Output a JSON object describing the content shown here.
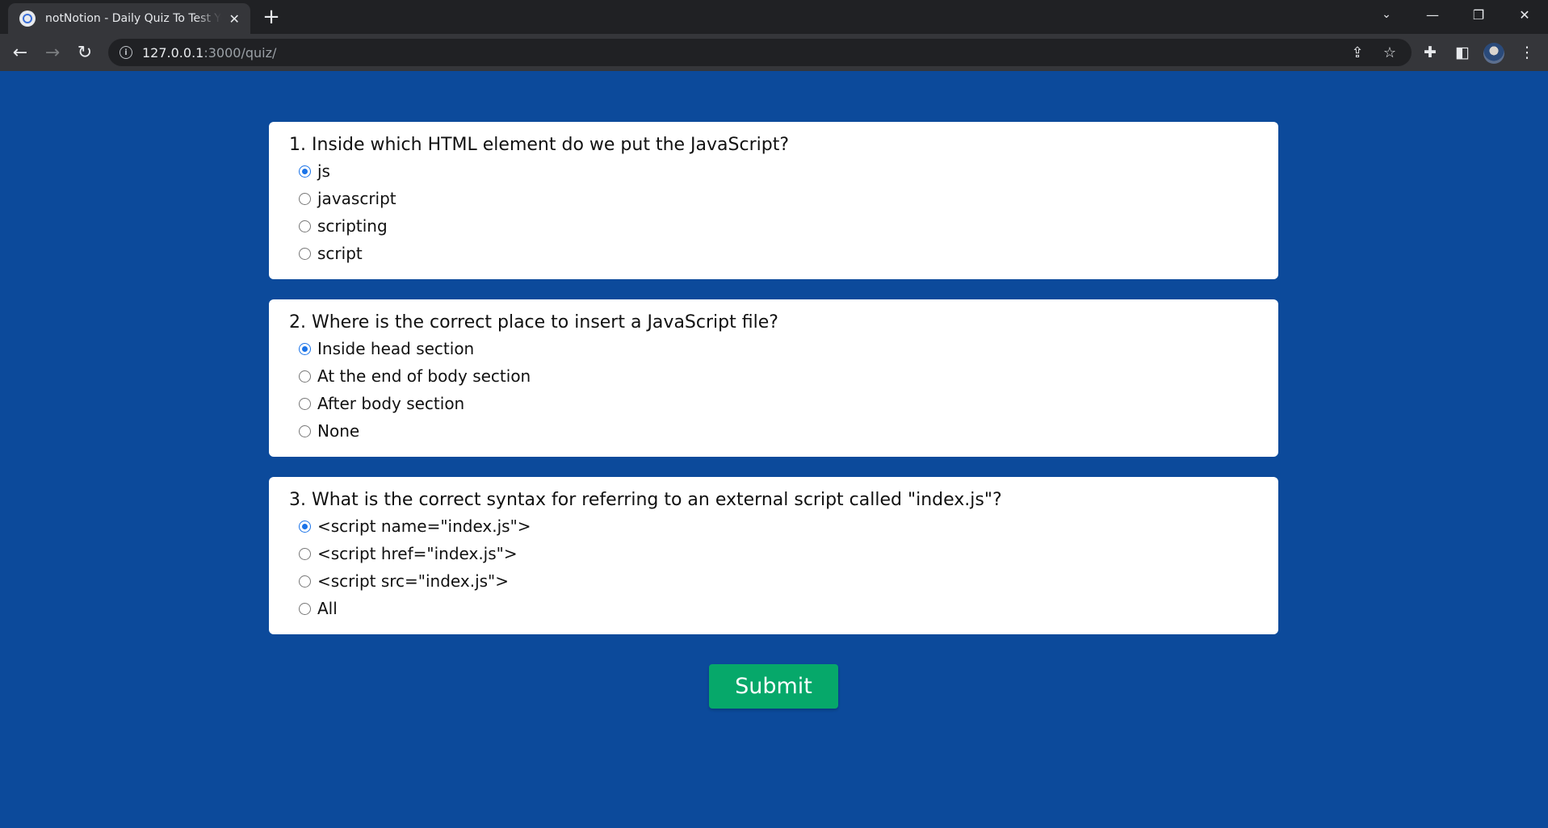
{
  "browser": {
    "tab_title": "notNotion - Daily Quiz To Test Your Knowledge",
    "url_host": "127.0.0.1",
    "url_rest": ":3000/quiz/"
  },
  "questions": [
    {
      "text": "1. Inside which HTML element do we put the JavaScript?",
      "options": [
        "js",
        "javascript",
        "scripting",
        "script"
      ],
      "selected": 0
    },
    {
      "text": "2. Where is the correct place to insert a JavaScript file?",
      "options": [
        "Inside head section",
        "At the end of body section",
        "After body section",
        "None"
      ],
      "selected": 0
    },
    {
      "text": "3. What is the correct syntax for referring to an external script called \"index.js\"?",
      "options": [
        "<script name=\"index.js\">",
        "<script href=\"index.js\">",
        "<script src=\"index.js\">",
        "All"
      ],
      "selected": 0
    }
  ],
  "submit_label": "Submit",
  "colors": {
    "page_background": "#0c4a9b",
    "submit_button": "#06a86a",
    "radio_selected": "#1a73e8"
  }
}
